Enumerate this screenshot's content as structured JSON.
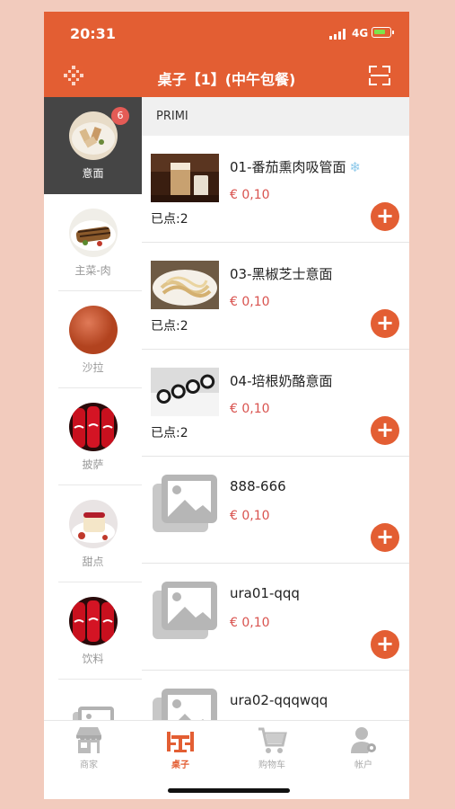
{
  "status_bar": {
    "time": "20:31",
    "network": "4G"
  },
  "header": {
    "title": "桌子【1】(中午包餐)",
    "left_icon": "qr-code-icon",
    "right_icon": "scan-icon"
  },
  "sidebar": {
    "badge_count": "6",
    "items": [
      {
        "label": "意面",
        "active": true
      },
      {
        "label": "主菜-肉"
      },
      {
        "label": "沙拉"
      },
      {
        "label": "披萨"
      },
      {
        "label": "甜点"
      },
      {
        "label": "饮料"
      },
      {
        "label": ""
      }
    ]
  },
  "main": {
    "section_title": "PRIMI",
    "items": [
      {
        "name": "01-番茄熏肉吸管面",
        "snow_icon": "❄",
        "price": "€ 0,10",
        "ordered": "已点:2"
      },
      {
        "name": "03-黑椒芝士意面",
        "price": "€ 0,10",
        "ordered": "已点:2"
      },
      {
        "name": "04-培根奶酪意面",
        "price": "€ 0,10",
        "ordered": "已点:2"
      },
      {
        "name": "888-666",
        "price": "€ 0,10",
        "ordered": ""
      },
      {
        "name": "ura01-qqq",
        "price": "€ 0,10",
        "ordered": ""
      },
      {
        "name": "ura02-qqqwqq",
        "price": "",
        "ordered": ""
      }
    ],
    "add_symbol": "+"
  },
  "tabbar": {
    "tabs": [
      {
        "label": "商家",
        "icon": "store-icon"
      },
      {
        "label": "桌子",
        "icon": "table-icon",
        "active": true
      },
      {
        "label": "购物车",
        "icon": "cart-icon"
      },
      {
        "label": "帐户",
        "icon": "account-icon"
      }
    ]
  },
  "colors": {
    "accent": "#e35e33",
    "price": "#d9534f",
    "sidebar_active": "#454545",
    "background": "#f2cbbd"
  }
}
